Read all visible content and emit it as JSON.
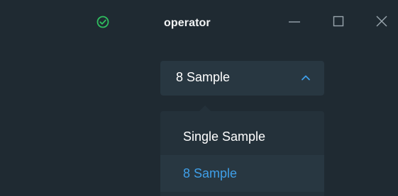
{
  "window": {
    "title": "operator",
    "status_icon": "check-circle-icon",
    "status_color": "#2fbf5f",
    "controls": [
      "minimize-icon",
      "maximize-icon",
      "close-icon"
    ]
  },
  "select": {
    "value": "8 Sample",
    "chevron": "chevron-up-icon",
    "accent_color": "#3f9fe8"
  },
  "dropdown": {
    "options": [
      {
        "label": "Single Sample",
        "selected": false
      },
      {
        "label": "8 Sample",
        "selected": true
      }
    ]
  }
}
